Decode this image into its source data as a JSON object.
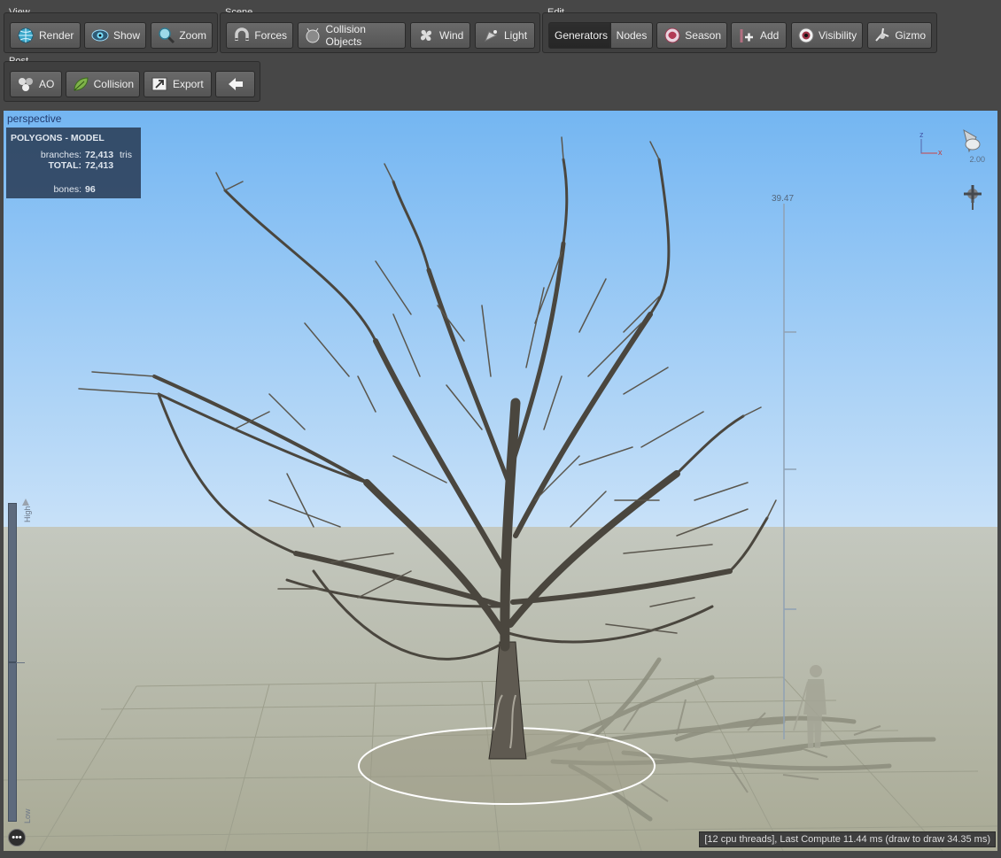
{
  "toolbar": {
    "view": {
      "label": "View",
      "buttons": [
        {
          "label": "Render",
          "icon": "globe-icon"
        },
        {
          "label": "Show",
          "icon": "eye-icon"
        },
        {
          "label": "Zoom",
          "icon": "magnifier-icon"
        }
      ]
    },
    "scene": {
      "label": "Scene",
      "buttons": [
        {
          "label": "Forces",
          "icon": "magnet-icon"
        },
        {
          "label": "Collision Objects",
          "icon": "sphere-icon"
        },
        {
          "label": "Wind",
          "icon": "fan-icon"
        },
        {
          "label": "Light",
          "icon": "lamp-icon"
        }
      ]
    },
    "edit": {
      "label": "Edit",
      "buttons": [
        {
          "label": "Generators",
          "icon": ""
        },
        {
          "label": "Nodes",
          "icon": ""
        },
        {
          "label": "Season",
          "icon": "season-icon"
        },
        {
          "label": "Add",
          "icon": "add-icon"
        },
        {
          "label": "Visibility",
          "icon": "eyeball-icon"
        },
        {
          "label": "Gizmo",
          "icon": "gizmo-icon"
        }
      ]
    },
    "post": {
      "label": "Post",
      "buttons": [
        {
          "label": "AO",
          "icon": "spheres-icon"
        },
        {
          "label": "Collision",
          "icon": "leaf-icon"
        },
        {
          "label": "Export",
          "icon": "export-icon"
        },
        {
          "label": "",
          "icon": "arrow-left-icon"
        }
      ]
    }
  },
  "viewport": {
    "label": "perspective",
    "stats": {
      "title": "POLYGONS - MODEL",
      "branches_label": "branches:",
      "branches_value": "72,413",
      "branches_unit": "tris",
      "total_label": "TOTAL:",
      "total_value": "72,413",
      "bones_label": "bones:",
      "bones_value": "96"
    },
    "height_value": "39.47",
    "axis_z": "z",
    "axis_x": "x",
    "light_intensity": "2.00",
    "lod_high": "High",
    "lod_low": "Low",
    "status": "[12 cpu threads], Last Compute 11.44 ms (draw to draw 34.35 ms)",
    "more_label": "•••"
  },
  "colors": {
    "sky_top": "#74b6f2",
    "sky_bottom": "#c8e1f8",
    "ground": "#aeaf9b",
    "accent_selected": "#2a2a2a"
  }
}
